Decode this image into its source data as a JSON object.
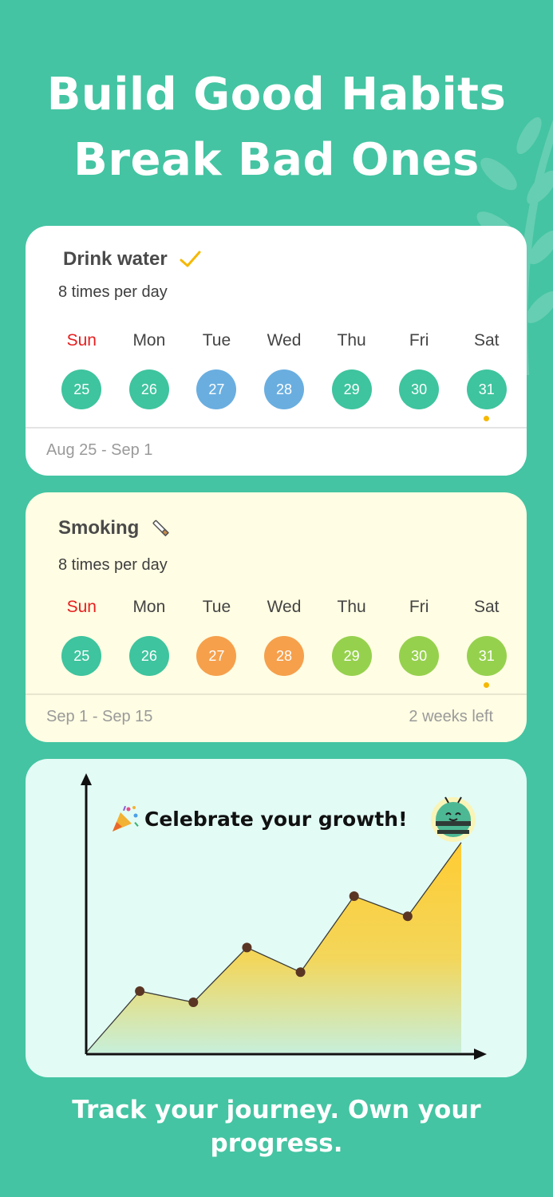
{
  "headline": {
    "line1": "Build Good Habits",
    "line2": "Break Bad Ones"
  },
  "water_card": {
    "title": "Drink water",
    "frequency": "8 times per day",
    "days": [
      {
        "label": "Sun",
        "date": "25",
        "color": "#3ec49e",
        "sunday": true
      },
      {
        "label": "Mon",
        "date": "26",
        "color": "#3ec49e"
      },
      {
        "label": "Tue",
        "date": "27",
        "color": "#6aaee0"
      },
      {
        "label": "Wed",
        "date": "28",
        "color": "#6aaee0"
      },
      {
        "label": "Thu",
        "date": "29",
        "color": "#3ec49e"
      },
      {
        "label": "Fri",
        "date": "30",
        "color": "#3ec49e"
      },
      {
        "label": "Sat",
        "date": "31",
        "color": "#3ec49e",
        "today": true
      }
    ],
    "range": "Aug 25 - Sep 1"
  },
  "smoke_card": {
    "title": "Smoking",
    "frequency": "8 times per day",
    "days": [
      {
        "label": "Sun",
        "date": "25",
        "color": "#3ec49e",
        "sunday": true
      },
      {
        "label": "Mon",
        "date": "26",
        "color": "#3ec49e"
      },
      {
        "label": "Tue",
        "date": "27",
        "color": "#f6a04c"
      },
      {
        "label": "Wed",
        "date": "28",
        "color": "#f6a04c"
      },
      {
        "label": "Thu",
        "date": "29",
        "color": "#96d14e"
      },
      {
        "label": "Fri",
        "date": "30",
        "color": "#96d14e"
      },
      {
        "label": "Sat",
        "date": "31",
        "color": "#96d14e",
        "today": true
      }
    ],
    "range": "Sep 1 - Sep 15",
    "remaining": "2 weeks left"
  },
  "growth_card": {
    "caption": "Celebrate your growth!",
    "party_icon": "party-popper-icon",
    "mascot": "bee-mascot"
  },
  "chart_data": {
    "type": "area",
    "title": "Celebrate your growth!",
    "xlabel": "",
    "ylabel": "",
    "x": [
      0,
      1,
      2,
      3,
      4,
      5,
      6,
      7
    ],
    "values": [
      0,
      5.5,
      4.5,
      9.4,
      7.2,
      14.0,
      12.2,
      18.8
    ],
    "ylim": [
      0,
      22
    ],
    "grid": false,
    "colors": {
      "top": "#ffcc33",
      "bottom": "#c7efd9",
      "line": "#3a3a3a",
      "marker": "#5a3524"
    }
  },
  "tagline": "Track your journey. Own your progress.",
  "colors": {
    "background": "#44c4a2",
    "sunday_label": "#e61e1e",
    "today_dot": "#f5b800",
    "check": "#f5b800"
  }
}
